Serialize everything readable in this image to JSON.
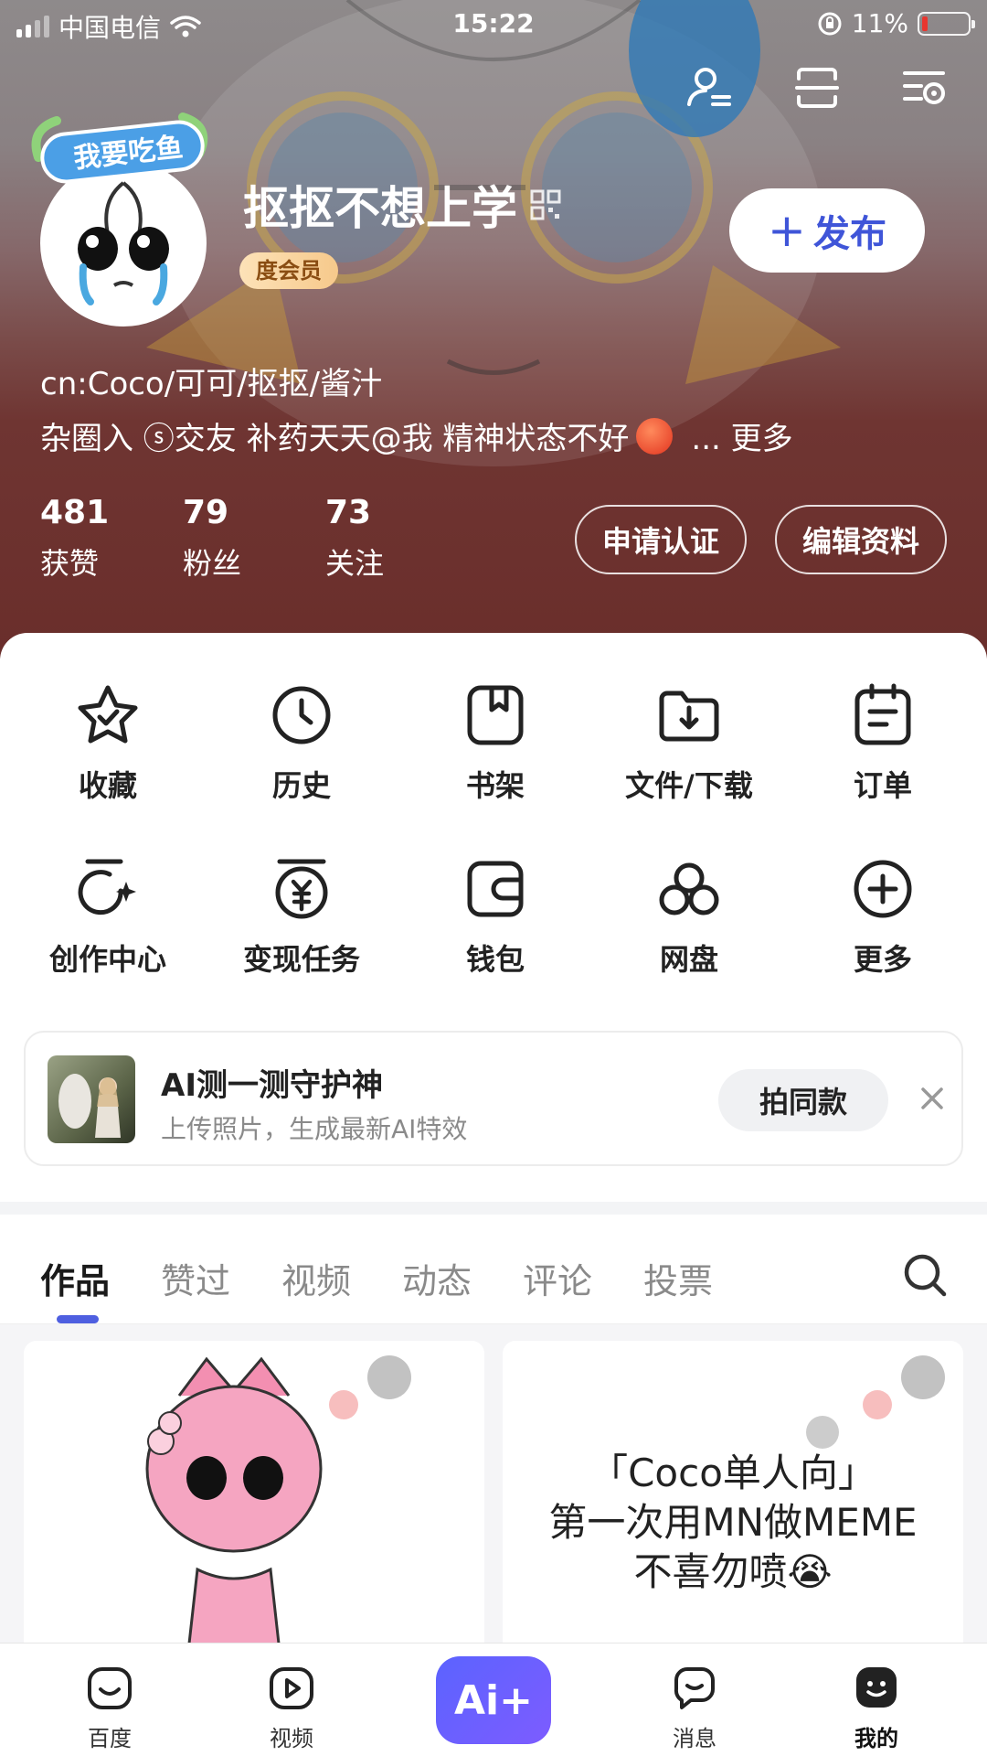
{
  "status_bar": {
    "carrier": "中国电信",
    "time": "15:22",
    "battery": "11%"
  },
  "profile": {
    "avatar_badge": "我要吃鱼",
    "username": "抠抠不想上学",
    "vip_label": "度会员",
    "publish_label": "发布",
    "bio_line1": "cn:Coco/可可/抠抠/酱汁",
    "bio_line2": "杂圈入 ⓢ交友 补药天天@我 精神状态不好",
    "bio_more": "... 更多",
    "stats": [
      {
        "value": "481",
        "label": "获赞"
      },
      {
        "value": "79",
        "label": "粉丝"
      },
      {
        "value": "73",
        "label": "关注"
      }
    ],
    "verify_button": "申请认证",
    "edit_button": "编辑资料"
  },
  "grid": {
    "row1": [
      {
        "label": "收藏",
        "icon": "star-icon"
      },
      {
        "label": "历史",
        "icon": "clock-icon"
      },
      {
        "label": "书架",
        "icon": "bookshelf-icon"
      },
      {
        "label": "文件/下载",
        "icon": "download-folder-icon"
      },
      {
        "label": "订单",
        "icon": "order-icon"
      }
    ],
    "row2": [
      {
        "label": "创作中心",
        "icon": "creation-icon"
      },
      {
        "label": "变现任务",
        "icon": "monetize-icon"
      },
      {
        "label": "钱包",
        "icon": "wallet-icon"
      },
      {
        "label": "网盘",
        "icon": "cloud-disk-icon"
      },
      {
        "label": "更多",
        "icon": "plus-circle-icon"
      }
    ]
  },
  "promo": {
    "title": "AI测一测守护神",
    "subtitle": "上传照片，生成最新AI特效",
    "button": "拍同款"
  },
  "tabs": [
    "作品",
    "赞过",
    "视频",
    "动态",
    "评论",
    "投票"
  ],
  "feed": {
    "right_card_text": [
      "「Coco单人向」",
      "第一次用MN做MEME",
      "不喜勿喷😭"
    ]
  },
  "bottom_nav": [
    {
      "label": "百度",
      "icon": "baidu-home-icon"
    },
    {
      "label": "视频",
      "icon": "video-icon"
    },
    {
      "label": "Ai+",
      "icon": "ai-plus-icon"
    },
    {
      "label": "消息",
      "icon": "message-icon"
    },
    {
      "label": "我的",
      "icon": "me-icon"
    }
  ],
  "colors": {
    "accent": "#3f55d8",
    "tab_underline": "#4e5fe0",
    "header_bottom": "#6a2e2b"
  }
}
